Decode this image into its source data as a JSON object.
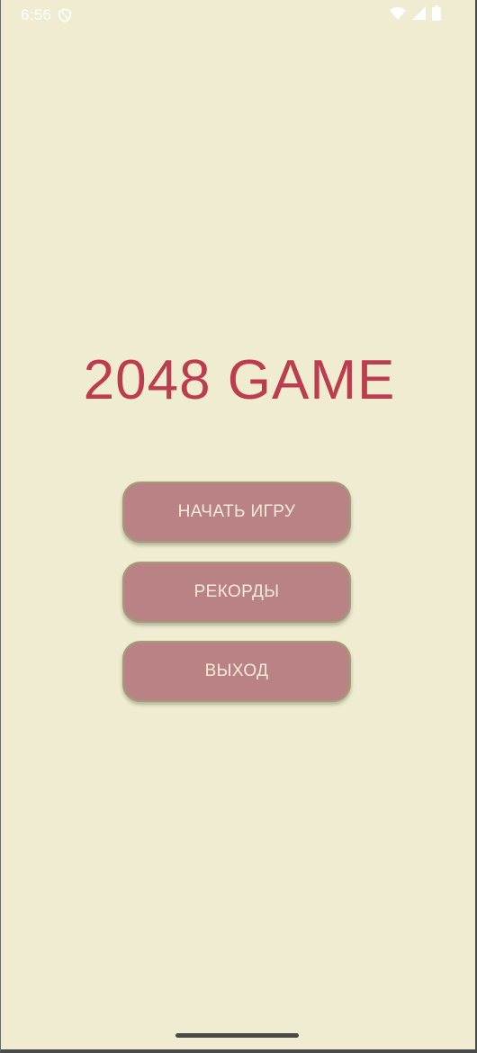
{
  "status_bar": {
    "time": "6:56",
    "icons": [
      "shield-icon",
      "wifi-icon",
      "cell-signal-icon",
      "battery-icon"
    ]
  },
  "main": {
    "title": "2048 GAME",
    "buttons": {
      "start_label": "НАЧАТЬ ИГРУ",
      "records_label": "РЕКОРДЫ",
      "exit_label": "ВЫХОД"
    }
  },
  "colors": {
    "background": "#efecd2",
    "title": "#bd3d4e",
    "button_fill": "#b98385",
    "button_border": "#a59c73",
    "button_text": "#f6ead6"
  }
}
